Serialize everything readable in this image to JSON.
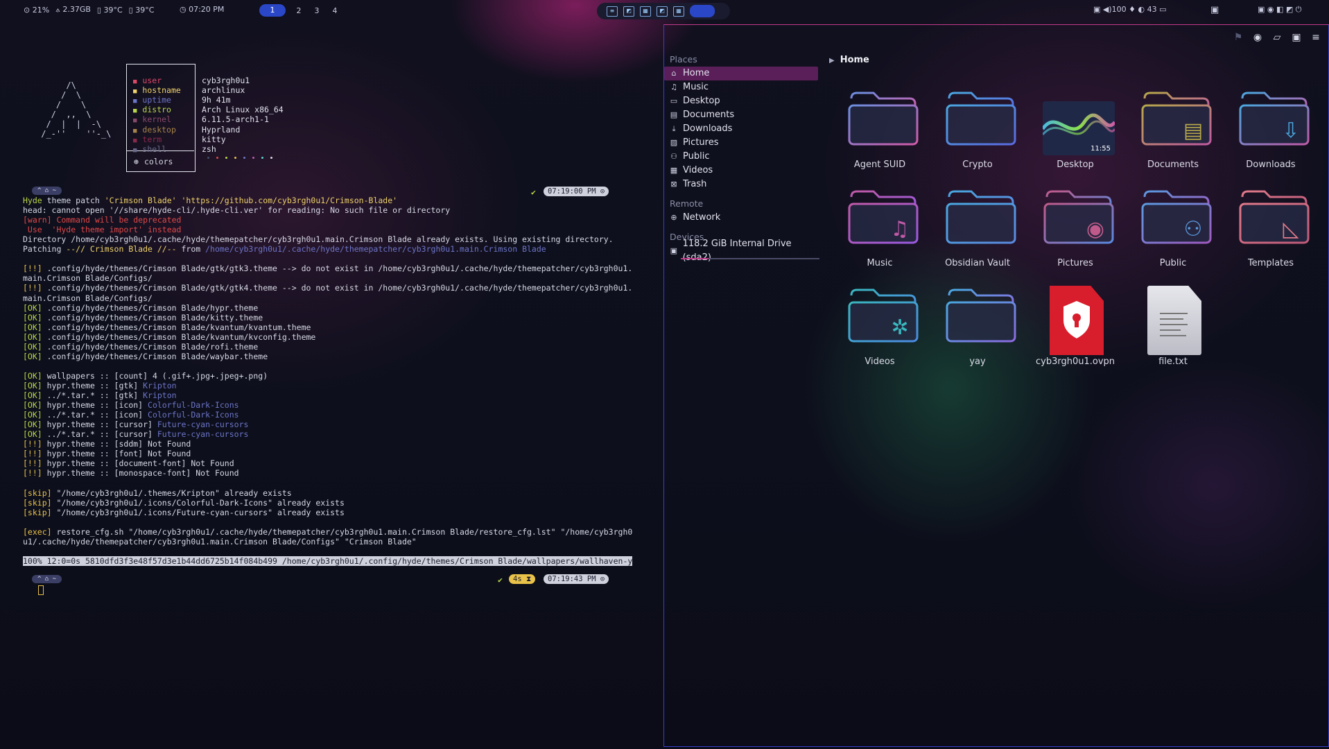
{
  "topbar": {
    "sys_left": [
      "⊙ 21%",
      "⟑ 2.37GB",
      "▯ 39°C",
      "▯ 39°C"
    ],
    "clock": "◷ 07:20 PM",
    "workspaces": [
      "1",
      "2",
      "3",
      "4"
    ],
    "active_workspace": "1",
    "tray_right": "▣ ◀)100 ♦ ◐ 43 ▭",
    "tray_icons": "▣ ◉ ◧ ◩ ⏻"
  },
  "terminal": {
    "fetch": {
      "logo": "      /\\\n     /  \\\n    /    \\\n   /  ,,  \\\n  /  |  |  -\\\n /_-''    ''-_\\",
      "rows": [
        {
          "key": "user",
          "value": "cyb3rgh0u1",
          "color": "#e04866"
        },
        {
          "key": "hostname",
          "value": "archlinux",
          "color": "#f0d36a"
        },
        {
          "key": "uptime",
          "value": "9h 41m",
          "color": "#6d76c9"
        },
        {
          "key": "distro",
          "value": "Arch Linux x86_64",
          "color": "#b9d74a"
        },
        {
          "key": "kernel",
          "value": "6.11.5-arch1-1",
          "color": "#8a4a6a"
        },
        {
          "key": "desktop",
          "value": "Hyprland",
          "color": "#a8844a"
        },
        {
          "key": "term",
          "value": "kitty",
          "color": "#8a2a4a"
        },
        {
          "key": "shell",
          "value": "zsh",
          "color": "#6a6a8a"
        }
      ],
      "colors_label": "colors",
      "color_dots": [
        "#444a66",
        "#e04848",
        "#b9d74a",
        "#e9c24a",
        "#6d76c9",
        "#c05ab0",
        "#5ad0d0",
        "#d7d9e6"
      ]
    },
    "prompt_left": "^  ⌂ ~",
    "prompt_time_1": "07:19:00 PM ⊙",
    "prompt_time_2": "07:19:43 PM ⊙",
    "prompt_duration": "4s ⧗",
    "lines": [
      {
        "cls": "",
        "parts": [
          {
            "t": "Hyde",
            "c": "ok"
          },
          {
            "t": " theme patch ",
            "c": ""
          },
          {
            "t": "'Crimson Blade' 'https://github.com/cyb3rgh0u1/Crimson-Blade'",
            "c": "yel"
          }
        ]
      },
      {
        "parts": [
          {
            "t": "head: cannot open '//share/hyde-cli/.hyde-cli.ver' for reading: No such file or directory",
            "c": ""
          }
        ]
      },
      {
        "parts": [
          {
            "t": "[warn] Command will be deprecated",
            "c": "warn"
          }
        ]
      },
      {
        "parts": [
          {
            "t": " Use  'Hyde theme import' instead",
            "c": "warn"
          }
        ]
      },
      {
        "parts": [
          {
            "t": "Directory /home/cyb3rgh0u1/.cache/hyde/themepatcher/cyb3rgh0u1.main.Crimson Blade already exists. Using existing directory.",
            "c": ""
          }
        ]
      },
      {
        "parts": [
          {
            "t": "Patching ",
            "c": ""
          },
          {
            "t": "--// Crimson Blade //--",
            "c": "yel"
          },
          {
            "t": " from ",
            "c": ""
          },
          {
            "t": "/home/cyb3rgh0u1/.cache/hyde/themepatcher/cyb3rgh0u1.main.Crimson Blade",
            "c": "dim"
          }
        ]
      },
      {
        "parts": [
          {
            "t": "",
            "c": ""
          }
        ]
      },
      {
        "parts": [
          {
            "t": "[!!]",
            "c": "skip"
          },
          {
            "t": " .config/hyde/themes/Crimson Blade/gtk/gtk3.theme --> do not exist in /home/cyb3rgh0u1/.cache/hyde/themepatcher/cyb3rgh0u1.",
            "c": ""
          }
        ]
      },
      {
        "parts": [
          {
            "t": "main.Crimson Blade/Configs/",
            "c": ""
          }
        ]
      },
      {
        "parts": [
          {
            "t": "[!!]",
            "c": "skip"
          },
          {
            "t": " .config/hyde/themes/Crimson Blade/gtk/gtk4.theme --> do not exist in /home/cyb3rgh0u1/.cache/hyde/themepatcher/cyb3rgh0u1.",
            "c": ""
          }
        ]
      },
      {
        "parts": [
          {
            "t": "main.Crimson Blade/Configs/",
            "c": ""
          }
        ]
      },
      {
        "parts": [
          {
            "t": "[OK]",
            "c": "ok"
          },
          {
            "t": " .config/hyde/themes/Crimson Blade/hypr.theme",
            "c": ""
          }
        ]
      },
      {
        "parts": [
          {
            "t": "[OK]",
            "c": "ok"
          },
          {
            "t": " .config/hyde/themes/Crimson Blade/kitty.theme",
            "c": ""
          }
        ]
      },
      {
        "parts": [
          {
            "t": "[OK]",
            "c": "ok"
          },
          {
            "t": " .config/hyde/themes/Crimson Blade/kvantum/kvantum.theme",
            "c": ""
          }
        ]
      },
      {
        "parts": [
          {
            "t": "[OK]",
            "c": "ok"
          },
          {
            "t": " .config/hyde/themes/Crimson Blade/kvantum/kvconfig.theme",
            "c": ""
          }
        ]
      },
      {
        "parts": [
          {
            "t": "[OK]",
            "c": "ok"
          },
          {
            "t": " .config/hyde/themes/Crimson Blade/rofi.theme",
            "c": ""
          }
        ]
      },
      {
        "parts": [
          {
            "t": "[OK]",
            "c": "ok"
          },
          {
            "t": " .config/hyde/themes/Crimson Blade/waybar.theme",
            "c": ""
          }
        ]
      },
      {
        "parts": [
          {
            "t": "",
            "c": ""
          }
        ]
      },
      {
        "parts": [
          {
            "t": "[OK]",
            "c": "ok"
          },
          {
            "t": " wallpapers :: [count] 4 (.gif+.jpg+.jpeg+.png)",
            "c": ""
          }
        ]
      },
      {
        "parts": [
          {
            "t": "[OK]",
            "c": "ok"
          },
          {
            "t": " hypr.theme :: [gtk] ",
            "c": ""
          },
          {
            "t": "Kripton",
            "c": "dim"
          }
        ]
      },
      {
        "parts": [
          {
            "t": "[OK]",
            "c": "ok"
          },
          {
            "t": " ../*.tar.* :: [gtk] ",
            "c": ""
          },
          {
            "t": "Kripton",
            "c": "dim"
          }
        ]
      },
      {
        "parts": [
          {
            "t": "[OK]",
            "c": "ok"
          },
          {
            "t": " hypr.theme :: [icon] ",
            "c": ""
          },
          {
            "t": "Colorful-Dark-Icons",
            "c": "dim"
          }
        ]
      },
      {
        "parts": [
          {
            "t": "[OK]",
            "c": "ok"
          },
          {
            "t": " ../*.tar.* :: [icon] ",
            "c": ""
          },
          {
            "t": "Colorful-Dark-Icons",
            "c": "dim"
          }
        ]
      },
      {
        "parts": [
          {
            "t": "[OK]",
            "c": "ok"
          },
          {
            "t": " hypr.theme :: [cursor] ",
            "c": ""
          },
          {
            "t": "Future-cyan-cursors",
            "c": "dim"
          }
        ]
      },
      {
        "parts": [
          {
            "t": "[OK]",
            "c": "ok"
          },
          {
            "t": " ../*.tar.* :: [cursor] ",
            "c": ""
          },
          {
            "t": "Future-cyan-cursors",
            "c": "dim"
          }
        ]
      },
      {
        "parts": [
          {
            "t": "[!!]",
            "c": "skip"
          },
          {
            "t": " hypr.theme :: [sddm] Not Found",
            "c": ""
          }
        ]
      },
      {
        "parts": [
          {
            "t": "[!!]",
            "c": "skip"
          },
          {
            "t": " hypr.theme :: [font] Not Found",
            "c": ""
          }
        ]
      },
      {
        "parts": [
          {
            "t": "[!!]",
            "c": "skip"
          },
          {
            "t": " hypr.theme :: [document-font] Not Found",
            "c": ""
          }
        ]
      },
      {
        "parts": [
          {
            "t": "[!!]",
            "c": "skip"
          },
          {
            "t": " hypr.theme :: [monospace-font] Not Found",
            "c": ""
          }
        ]
      },
      {
        "parts": [
          {
            "t": "",
            "c": ""
          }
        ]
      },
      {
        "parts": [
          {
            "t": "[skip]",
            "c": "skip"
          },
          {
            "t": " \"/home/cyb3rgh0u1/.themes/Kripton\" already exists",
            "c": ""
          }
        ]
      },
      {
        "parts": [
          {
            "t": "[skip]",
            "c": "skip"
          },
          {
            "t": " \"/home/cyb3rgh0u1/.icons/Colorful-Dark-Icons\" already exists",
            "c": ""
          }
        ]
      },
      {
        "parts": [
          {
            "t": "[skip]",
            "c": "skip"
          },
          {
            "t": " \"/home/cyb3rgh0u1/.icons/Future-cyan-cursors\" already exists",
            "c": ""
          }
        ]
      },
      {
        "parts": [
          {
            "t": "",
            "c": ""
          }
        ]
      },
      {
        "parts": [
          {
            "t": "[exec]",
            "c": "exec"
          },
          {
            "t": " restore_cfg.sh \"/home/cyb3rgh0u1/.cache/hyde/themepatcher/cyb3rgh0u1.main.Crimson Blade/restore_cfg.lst\" \"/home/cyb3rgh0",
            "c": ""
          }
        ]
      },
      {
        "parts": [
          {
            "t": "u1/.cache/hyde/themepatcher/cyb3rgh0u1.main.Crimson Blade/Configs\" \"Crimson Blade\"",
            "c": ""
          }
        ]
      },
      {
        "parts": [
          {
            "t": "",
            "c": ""
          }
        ]
      },
      {
        "parts": [
          {
            "t": "100% 12:0=0s 5810dfd3f3e48f57d3e1b44dd6725b14f084b499 /home/cyb3rgh0u1/.config/hyde/themes/Crimson Blade/wallpapers/wallhaven-y",
            "c": "sel"
          }
        ]
      }
    ]
  },
  "filemanager": {
    "breadcrumb": "Home",
    "sections": [
      {
        "title": "Places",
        "items": [
          {
            "label": "Home",
            "icon": "⌂",
            "name": "home",
            "active": true
          },
          {
            "label": "Music",
            "icon": "♫",
            "name": "music"
          },
          {
            "label": "Desktop",
            "icon": "▭",
            "name": "desktop"
          },
          {
            "label": "Documents",
            "icon": "▤",
            "name": "documents"
          },
          {
            "label": "Downloads",
            "icon": "⤓",
            "name": "downloads"
          },
          {
            "label": "Pictures",
            "icon": "▨",
            "name": "pictures"
          },
          {
            "label": "Public",
            "icon": "⚇",
            "name": "public"
          },
          {
            "label": "Videos",
            "icon": "▦",
            "name": "videos"
          },
          {
            "label": "Trash",
            "icon": "⊠",
            "name": "trash"
          }
        ]
      },
      {
        "title": "Remote",
        "items": [
          {
            "label": "Network",
            "icon": "⊕",
            "name": "network"
          }
        ]
      },
      {
        "title": "Devices",
        "items": [
          {
            "label": "118.2 GiB Internal Drive (sda2)",
            "icon": "▣",
            "name": "drive",
            "usage": 0.2
          }
        ]
      }
    ],
    "desktop_thumb_time": "11:55",
    "files": [
      {
        "label": "Agent SUID",
        "type": "folder",
        "glyph": "",
        "c1": "#6c8fe0",
        "c2": "#d05aa8",
        "name": "agent-suid"
      },
      {
        "label": "Crypto",
        "type": "folder",
        "glyph": "",
        "c1": "#4aa8e0",
        "c2": "#5a6ae0",
        "name": "crypto"
      },
      {
        "label": "Desktop",
        "type": "thumb",
        "glyph": "",
        "c1": "#4ab8e0",
        "c2": "#d05aa8",
        "name": "desktop"
      },
      {
        "label": "Documents",
        "type": "folder",
        "glyph": "▤",
        "c1": "#b6a84a",
        "c2": "#c05aa0",
        "name": "documents"
      },
      {
        "label": "Downloads",
        "type": "folder",
        "glyph": "⇩",
        "c1": "#4aa8e0",
        "c2": "#c05aa8",
        "name": "downloads"
      },
      {
        "label": "Music",
        "type": "folder",
        "glyph": "♫",
        "c1": "#c05aa8",
        "c2": "#9a5ae0",
        "name": "music"
      },
      {
        "label": "Obsidian Vault",
        "type": "folder",
        "glyph": "",
        "c1": "#4aa8e0",
        "c2": "#5a8ae0",
        "name": "obsidian-vault"
      },
      {
        "label": "Pictures",
        "type": "folder",
        "glyph": "◉",
        "c1": "#c05a8a",
        "c2": "#5a8ae0",
        "name": "pictures"
      },
      {
        "label": "Public",
        "type": "folder",
        "glyph": "⚇",
        "c1": "#5a9ae0",
        "c2": "#a05ac0",
        "name": "public"
      },
      {
        "label": "Templates",
        "type": "folder",
        "glyph": "◺",
        "c1": "#e07a8a",
        "c2": "#c05a7a",
        "name": "templates"
      },
      {
        "label": "Videos",
        "type": "folder",
        "glyph": "✲",
        "c1": "#3ab8c0",
        "c2": "#4a8ae0",
        "name": "videos"
      },
      {
        "label": "yay",
        "type": "folder",
        "glyph": "",
        "c1": "#4aa8e0",
        "c2": "#8a6ae0",
        "name": "yay"
      },
      {
        "label": "cyb3rgh0u1.ovpn",
        "type": "ovpn",
        "glyph": "",
        "c1": "#d81e2c",
        "c2": "#b01020",
        "name": "ovpn-file"
      },
      {
        "label": "file.txt",
        "type": "txt",
        "glyph": "",
        "c1": "#e6e6ec",
        "c2": "#bcbcc6",
        "name": "text-file"
      }
    ]
  }
}
